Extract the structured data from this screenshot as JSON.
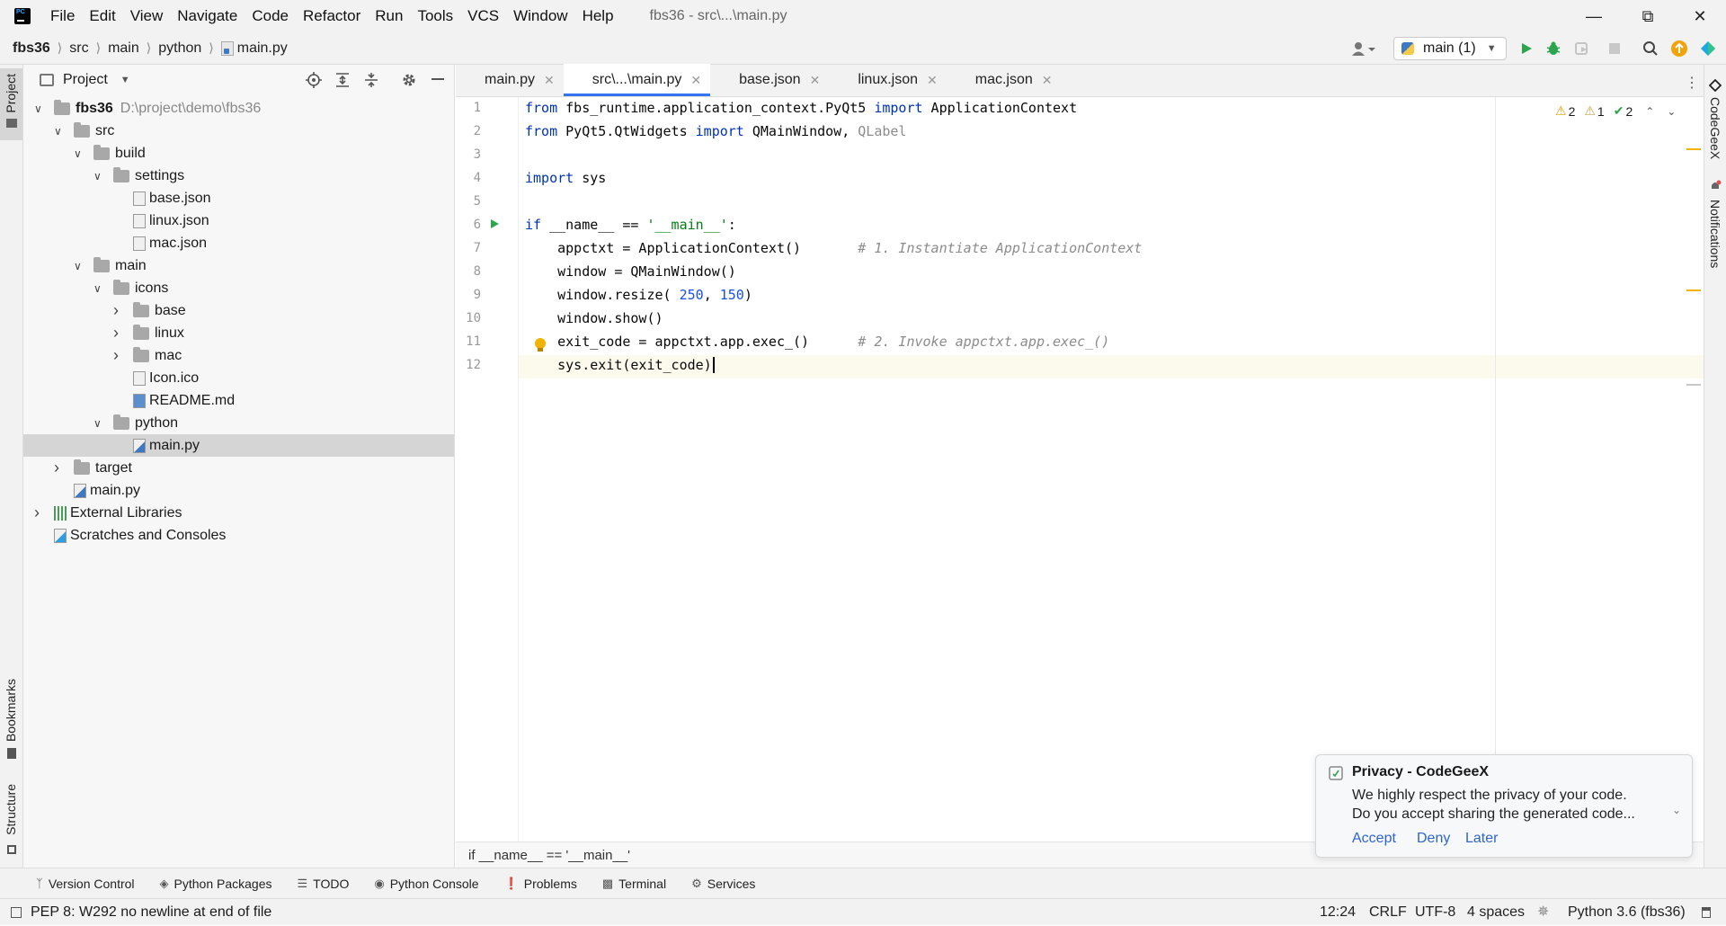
{
  "titlebar": {
    "menus": [
      "File",
      "Edit",
      "View",
      "Navigate",
      "Code",
      "Refactor",
      "Run",
      "Tools",
      "VCS",
      "Window",
      "Help"
    ],
    "title": "fbs36 - src\\...\\main.py"
  },
  "navbar": {
    "crumbs": [
      "fbs36",
      "src",
      "main",
      "python",
      "main.py"
    ],
    "run_config": "main (1)"
  },
  "left_stripe": {
    "project": "Project",
    "bookmarks": "Bookmarks",
    "structure": "Structure"
  },
  "right_stripe": {
    "codegeex": "CodeGeeX",
    "notifications": "Notifications"
  },
  "project": {
    "title": "Project",
    "tree": [
      {
        "label": "fbs36",
        "path": "D:\\project\\demo\\fbs36",
        "depth": 0,
        "kind": "folder",
        "open": true,
        "bold": true
      },
      {
        "label": "src",
        "depth": 1,
        "kind": "folder",
        "open": true
      },
      {
        "label": "build",
        "depth": 2,
        "kind": "folder",
        "open": true
      },
      {
        "label": "settings",
        "depth": 3,
        "kind": "folder",
        "open": true
      },
      {
        "label": "base.json",
        "depth": 4,
        "kind": "json"
      },
      {
        "label": "linux.json",
        "depth": 4,
        "kind": "json"
      },
      {
        "label": "mac.json",
        "depth": 4,
        "kind": "json"
      },
      {
        "label": "main",
        "depth": 2,
        "kind": "folder",
        "open": true
      },
      {
        "label": "icons",
        "depth": 3,
        "kind": "folder",
        "open": true
      },
      {
        "label": "base",
        "depth": 4,
        "kind": "folder",
        "open": false
      },
      {
        "label": "linux",
        "depth": 4,
        "kind": "folder",
        "open": false
      },
      {
        "label": "mac",
        "depth": 4,
        "kind": "folder",
        "open": false
      },
      {
        "label": "Icon.ico",
        "depth": 4,
        "kind": "file"
      },
      {
        "label": "README.md",
        "depth": 4,
        "kind": "md"
      },
      {
        "label": "python",
        "depth": 3,
        "kind": "folder",
        "open": true
      },
      {
        "label": "main.py",
        "depth": 4,
        "kind": "py",
        "selected": true
      },
      {
        "label": "target",
        "depth": 1,
        "kind": "folder",
        "open": false
      },
      {
        "label": "main.py",
        "depth": 1,
        "kind": "py"
      },
      {
        "label": "External Libraries",
        "depth": 0,
        "kind": "lib",
        "open": false
      },
      {
        "label": "Scratches and Consoles",
        "depth": 0,
        "kind": "scratch"
      }
    ]
  },
  "tabs": [
    {
      "label": "main.py",
      "kind": "py",
      "active": false
    },
    {
      "label": "src\\...\\main.py",
      "kind": "py",
      "active": true
    },
    {
      "label": "base.json",
      "kind": "json",
      "active": false
    },
    {
      "label": "linux.json",
      "kind": "json",
      "active": false
    },
    {
      "label": "mac.json",
      "kind": "json",
      "active": false
    }
  ],
  "inspections": {
    "warnings": "2",
    "weak_warnings": "1",
    "typos": "2"
  },
  "code_lines": [
    [
      [
        "kw",
        "from"
      ],
      [
        "",
        "fbs_runtime.application_context.PyQt5 "
      ],
      [
        "kw",
        "import"
      ],
      [
        "",
        "ApplicationContext"
      ]
    ],
    [
      [
        "kw",
        "from"
      ],
      [
        "",
        "PyQt5.QtWidgets "
      ],
      [
        "kw",
        "import"
      ],
      [
        "",
        "QMainWindow, "
      ],
      [
        "gray",
        "QLabel"
      ]
    ],
    [],
    [
      [
        "kw",
        "import"
      ],
      [
        "",
        "sys"
      ]
    ],
    [],
    [
      [
        "kw",
        "if"
      ],
      [
        "",
        " __name__ == "
      ],
      [
        "str",
        "'__main__'"
      ],
      [
        "",
        ":"
      ]
    ],
    [
      [
        "",
        "    appctxt = ApplicationContext()       "
      ],
      [
        "cm",
        "# 1. Instantiate ApplicationContext"
      ]
    ],
    [
      [
        "",
        "    window = QMainWindow()"
      ]
    ],
    [
      [
        "",
        "    window.resize("
      ],
      [
        "num",
        "250"
      ],
      [
        "",
        ", "
      ],
      [
        "num",
        "150"
      ],
      [
        "",
        ")"
      ]
    ],
    [
      [
        "",
        "    window.show()"
      ]
    ],
    [
      [
        "",
        "    exit_code = appctxt.app.exec_()      "
      ],
      [
        "cm",
        "# 2. Invoke appctxt.app.exec_()"
      ]
    ],
    [
      [
        "",
        "    sys.exit(exit_code)"
      ]
    ]
  ],
  "editor_breadcrumb": "if __name__ == '__main__'",
  "notification": {
    "title": "Privacy - CodeGeeX",
    "line1": "We highly respect the privacy of your code.",
    "line2": "Do you accept sharing the generated code...",
    "accept": "Accept",
    "deny": "Deny",
    "later": "Later"
  },
  "bottom_tools": [
    "Version Control",
    "Python Packages",
    "TODO",
    "Python Console",
    "Problems",
    "Terminal",
    "Services"
  ],
  "status": {
    "message": "PEP 8: W292 no newline at end of file",
    "position": "12:24",
    "line_sep": "CRLF",
    "encoding": "UTF-8",
    "indent": "4 spaces",
    "interpreter": "Python 3.6 (fbs36)"
  },
  "colors": {
    "accent": "#3574f0",
    "keyword": "#0033b3",
    "string": "#067d17",
    "number": "#1750eb",
    "comment": "#8c8c8c",
    "link": "#2f65ca"
  }
}
